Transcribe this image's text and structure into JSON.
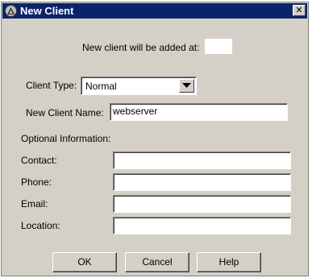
{
  "window": {
    "title": "New Client",
    "close_glyph": "✕"
  },
  "info": {
    "added_at_label": "New client will be added at:",
    "added_at_value": ""
  },
  "client_type": {
    "label": "Client Type:",
    "selected": "Normal"
  },
  "client_name": {
    "label": "New Client Name:",
    "value": "webserver"
  },
  "optional": {
    "header": "Optional Information:",
    "contact_label": "Contact:",
    "contact_value": "",
    "phone_label": "Phone:",
    "phone_value": "",
    "email_label": "Email:",
    "email_value": "",
    "location_label": "Location:",
    "location_value": ""
  },
  "buttons": {
    "ok": "OK",
    "cancel": "Cancel",
    "help": "Help"
  },
  "colors": {
    "titlebar": "#0a246a",
    "dialog_bg": "#d4d0c8"
  },
  "icons": {
    "title": "app-logo-icon",
    "close": "close-icon",
    "dropdown": "chevron-down-icon"
  }
}
